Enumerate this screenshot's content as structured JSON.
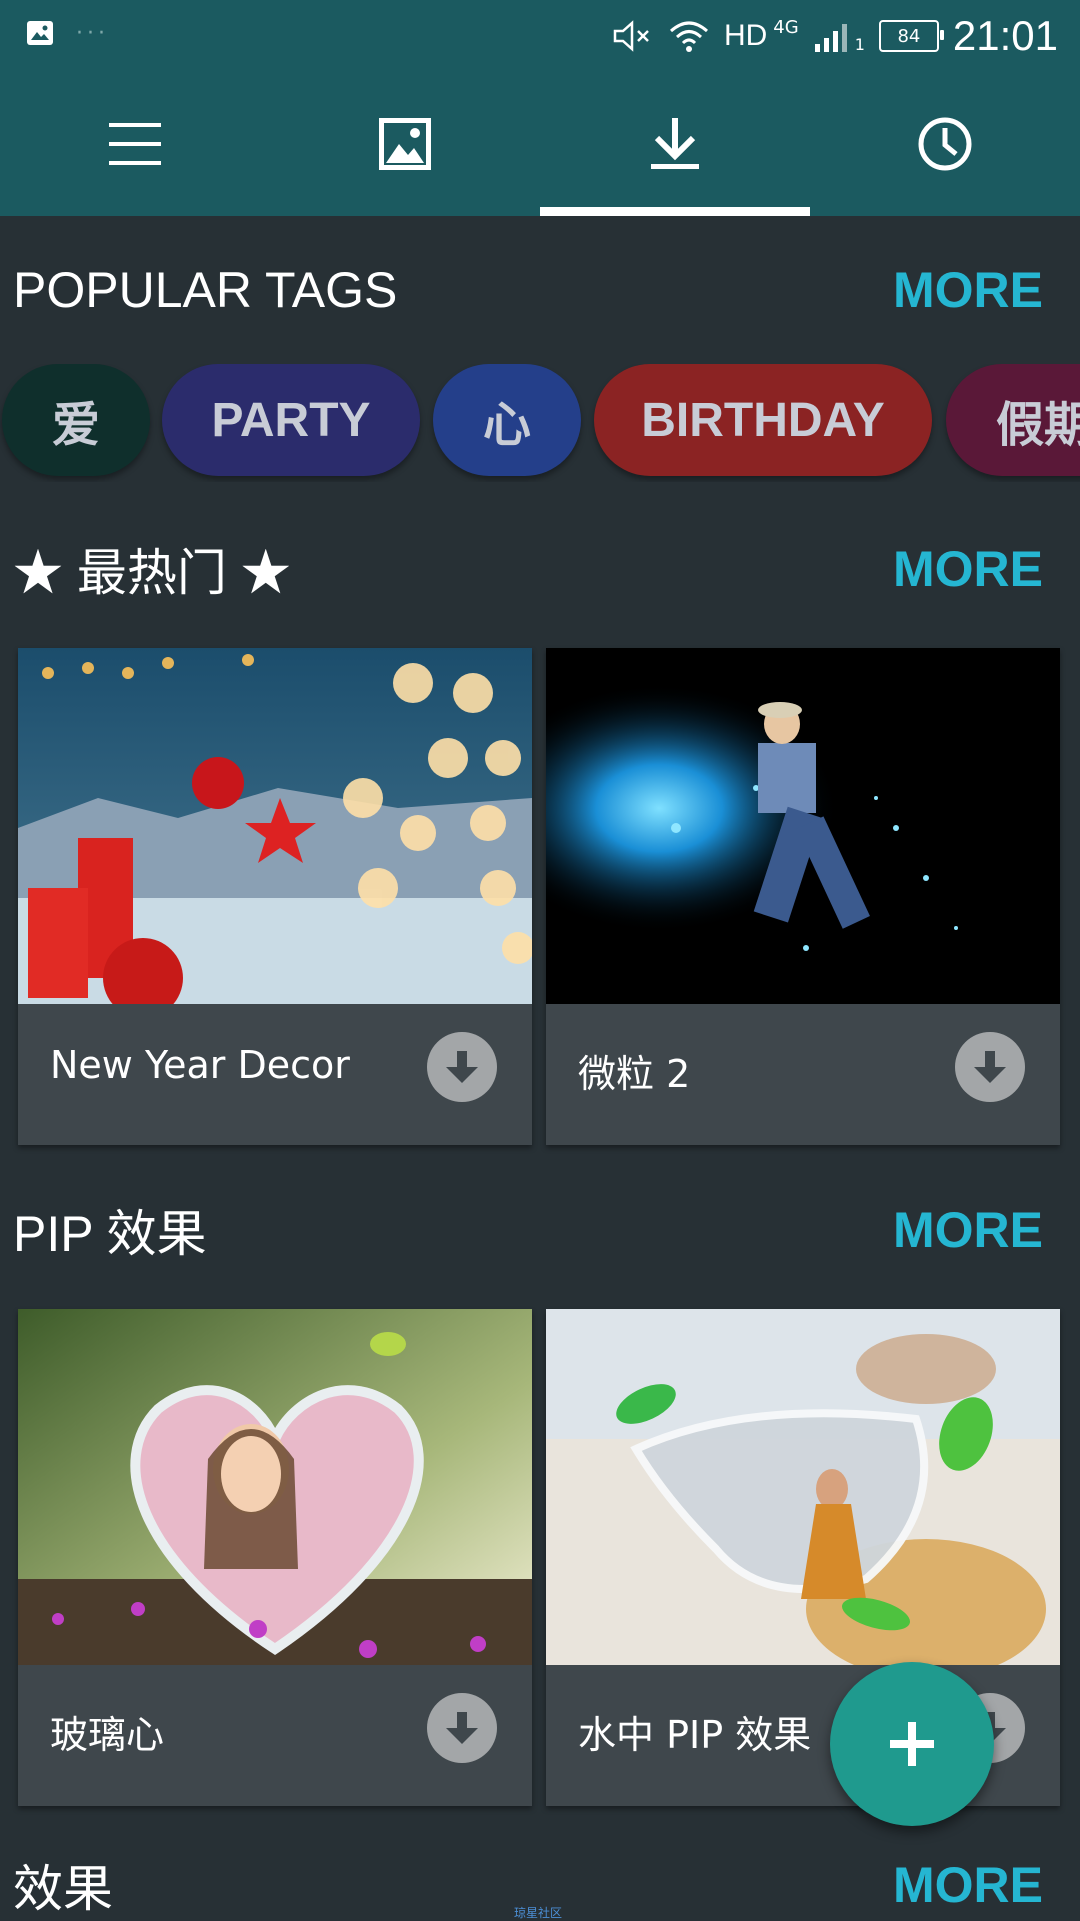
{
  "status_bar": {
    "network_type": "HD",
    "network_gen": "4G",
    "sim_slot": "1",
    "battery": "84",
    "time": "21:01"
  },
  "tabs": [
    {
      "icon": "menu-icon"
    },
    {
      "icon": "gallery-icon"
    },
    {
      "icon": "download-icon",
      "active": true
    },
    {
      "icon": "history-clock-icon"
    }
  ],
  "popular_tags": {
    "title": "POPULAR TAGS",
    "more": "MORE",
    "items": [
      {
        "label": "爱",
        "color": "#0f2f2c"
      },
      {
        "label": "PARTY",
        "color": "#2b2c6c"
      },
      {
        "label": "心",
        "color": "#243f8a"
      },
      {
        "label": "BIRTHDAY",
        "color": "#8b2323"
      },
      {
        "label": "假期",
        "color": "#5a1838"
      }
    ]
  },
  "hottest": {
    "title": "★ 最热门 ★",
    "more": "MORE",
    "cards": [
      {
        "label": "New Year Decor"
      },
      {
        "label": "微粒 2"
      }
    ]
  },
  "pip": {
    "title": "PIP 效果",
    "more": "MORE",
    "cards": [
      {
        "label": "玻璃心"
      },
      {
        "label": "水中 PIP 效果"
      }
    ]
  },
  "effects": {
    "title": "效果",
    "more": "MORE"
  },
  "watermark": "琼星社区",
  "colors": {
    "header": "#1b5a60",
    "background": "#273035",
    "card": "#3f474c",
    "accent": "#25b6d2",
    "fab": "#1f9a8e"
  }
}
